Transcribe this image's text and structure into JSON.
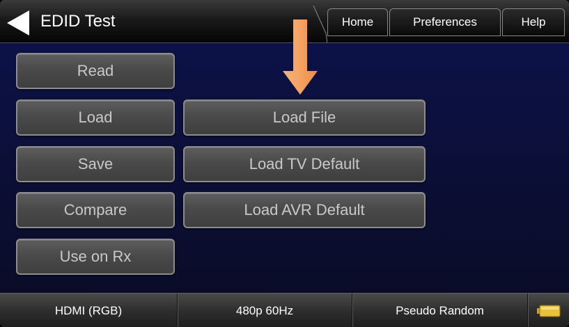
{
  "header": {
    "title": "EDID Test",
    "tabs": [
      {
        "label": "Home"
      },
      {
        "label": "Preferences"
      },
      {
        "label": "Help"
      }
    ]
  },
  "buttons": {
    "read": "Read",
    "load": "Load",
    "save": "Save",
    "compare": "Compare",
    "use_on_rx": "Use on Rx",
    "load_file": "Load File",
    "load_tv_default": "Load TV Default",
    "load_avr_default": "Load AVR Default"
  },
  "status_bar": {
    "interface": "HDMI (RGB)",
    "format": "480p 60Hz",
    "pattern": "Pseudo Random",
    "battery_icon": "battery-icon"
  },
  "colors": {
    "background": "#0c1142",
    "button_text": "#c9c9c9",
    "arrow": "#f4a261",
    "battery": "#e8c23a"
  },
  "icons": {
    "back": "back-arrow-icon",
    "annotation_arrow": "down-arrow-icon"
  }
}
